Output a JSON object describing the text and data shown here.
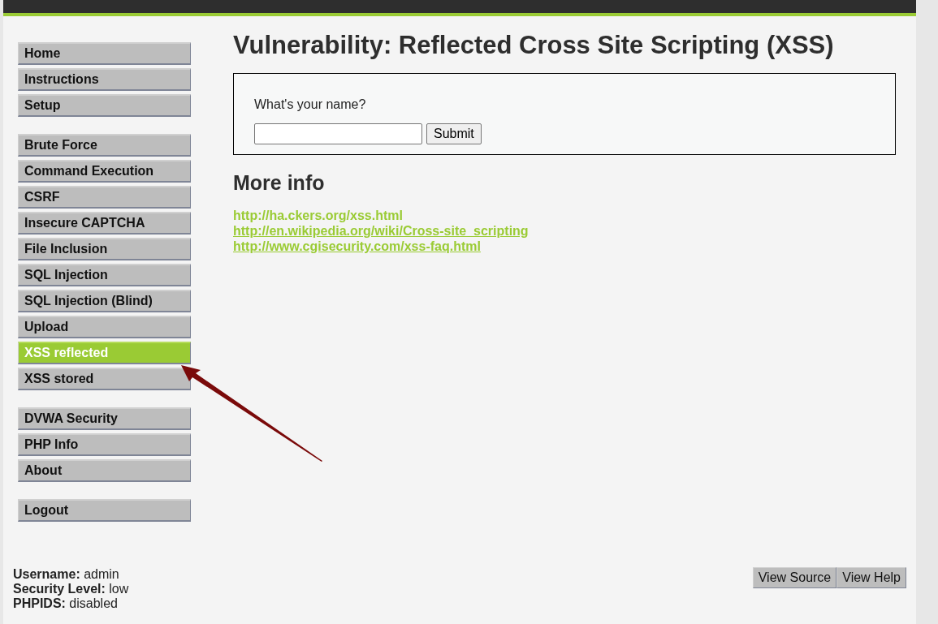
{
  "menu": [
    {
      "items": [
        {
          "label": "Home",
          "selected": false
        },
        {
          "label": "Instructions",
          "selected": false
        },
        {
          "label": "Setup",
          "selected": false
        }
      ]
    },
    {
      "items": [
        {
          "label": "Brute Force",
          "selected": false
        },
        {
          "label": "Command Execution",
          "selected": false
        },
        {
          "label": "CSRF",
          "selected": false
        },
        {
          "label": "Insecure CAPTCHA",
          "selected": false
        },
        {
          "label": "File Inclusion",
          "selected": false
        },
        {
          "label": "SQL Injection",
          "selected": false
        },
        {
          "label": "SQL Injection (Blind)",
          "selected": false
        },
        {
          "label": "Upload",
          "selected": false
        },
        {
          "label": "XSS reflected",
          "selected": true
        },
        {
          "label": "XSS stored",
          "selected": false
        }
      ]
    },
    {
      "items": [
        {
          "label": "DVWA Security",
          "selected": false
        },
        {
          "label": "PHP Info",
          "selected": false
        },
        {
          "label": "About",
          "selected": false
        }
      ]
    },
    {
      "items": [
        {
          "label": "Logout",
          "selected": false
        }
      ]
    }
  ],
  "title": "Vulnerability: Reflected Cross Site Scripting (XSS)",
  "form": {
    "question": "What's your name?",
    "submit": "Submit"
  },
  "more_info": {
    "heading": "More info",
    "links": [
      {
        "text": "http://ha.ckers.org/xss.html",
        "underlined": false
      },
      {
        "text": "http://en.wikipedia.org/wiki/Cross-site_scripting",
        "underlined": true
      },
      {
        "text": "http://www.cgisecurity.com/xss-faq.html",
        "underlined": true
      }
    ]
  },
  "status": [
    "**Username:** admin",
    "**Security Level:** low",
    "**PHPIDS:** disabled"
  ],
  "footer_buttons": [
    "View Source",
    "View Help"
  ]
}
